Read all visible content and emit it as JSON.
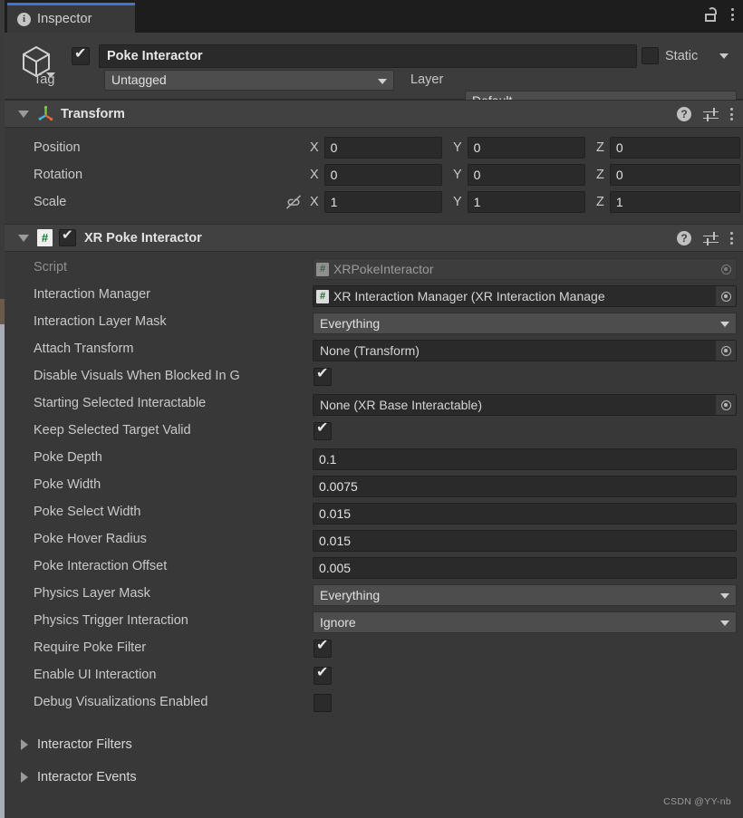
{
  "window": {
    "tab_label": "Inspector",
    "tab_icon": "info-icon",
    "lock_icon": "lock-open-icon",
    "menu_icon": "kebab-menu-icon",
    "accent_color": "#3a79d2",
    "panel_bg": "#383838"
  },
  "gameobject": {
    "icon": "cube-icon",
    "enabled": true,
    "name": "Poke Interactor",
    "static_label": "Static",
    "static_checked": false,
    "tag_label": "Tag",
    "tag_value": "Untagged",
    "layer_label": "Layer",
    "layer_value": "Default"
  },
  "components": [
    {
      "title": "Transform",
      "icon": "transform-axis-icon",
      "expanded": true,
      "help_icon": "help-icon",
      "preset_icon": "preset-settings-icon",
      "menu_icon": "kebab-menu-icon",
      "rows": [
        {
          "label": "Position",
          "x": "0",
          "y": "0",
          "z": "0",
          "link_icon": null
        },
        {
          "label": "Rotation",
          "x": "0",
          "y": "0",
          "z": "0",
          "link_icon": null
        },
        {
          "label": "Scale",
          "x": "1",
          "y": "1",
          "z": "1",
          "link_icon": "link-broken-icon"
        }
      ],
      "axis_labels": [
        "X",
        "Y",
        "Z"
      ]
    },
    {
      "title": "XR Poke Interactor",
      "icon": "script-hash-icon",
      "enabled": true,
      "expanded": true,
      "help_icon": "help-icon",
      "preset_icon": "preset-settings-icon",
      "menu_icon": "kebab-menu-icon",
      "properties": [
        {
          "label": "Script",
          "type": "object",
          "value": "XRPokeInteractor",
          "dim": true,
          "has_script_icon": true
        },
        {
          "label": "Interaction Manager",
          "type": "object",
          "value": "XR Interaction Manager (XR Interaction Manage",
          "dim": false,
          "has_script_icon": true
        },
        {
          "label": "Interaction Layer Mask",
          "type": "dropdown",
          "value": "Everything"
        },
        {
          "label": "Attach Transform",
          "type": "object",
          "value": "None (Transform)",
          "dim": false,
          "has_script_icon": false
        },
        {
          "label": "Disable Visuals When Blocked In G",
          "type": "checkbox",
          "checked": true,
          "truncated": true
        },
        {
          "label": "Starting Selected Interactable",
          "type": "object",
          "value": "None (XR Base Interactable)",
          "dim": false,
          "has_script_icon": false
        },
        {
          "label": "Keep Selected Target Valid",
          "type": "checkbox",
          "checked": true
        },
        {
          "label": "Poke Depth",
          "type": "text",
          "value": "0.1"
        },
        {
          "label": "Poke Width",
          "type": "text",
          "value": "0.0075"
        },
        {
          "label": "Poke Select Width",
          "type": "text",
          "value": "0.015"
        },
        {
          "label": "Poke Hover Radius",
          "type": "text",
          "value": "0.015"
        },
        {
          "label": "Poke Interaction Offset",
          "type": "text",
          "value": "0.005"
        },
        {
          "label": "Physics Layer Mask",
          "type": "dropdown",
          "value": "Everything"
        },
        {
          "label": "Physics Trigger Interaction",
          "type": "dropdown",
          "value": "Ignore"
        },
        {
          "label": "Require Poke Filter",
          "type": "checkbox",
          "checked": true
        },
        {
          "label": "Enable UI Interaction",
          "type": "checkbox",
          "checked": true
        },
        {
          "label": "Debug Visualizations Enabled",
          "type": "checkbox",
          "checked": false
        }
      ],
      "foldouts": [
        {
          "label": "Interactor Filters",
          "expanded": false
        },
        {
          "label": "Interactor Events",
          "expanded": false
        }
      ]
    }
  ],
  "watermark": "CSDN @YY-nb"
}
